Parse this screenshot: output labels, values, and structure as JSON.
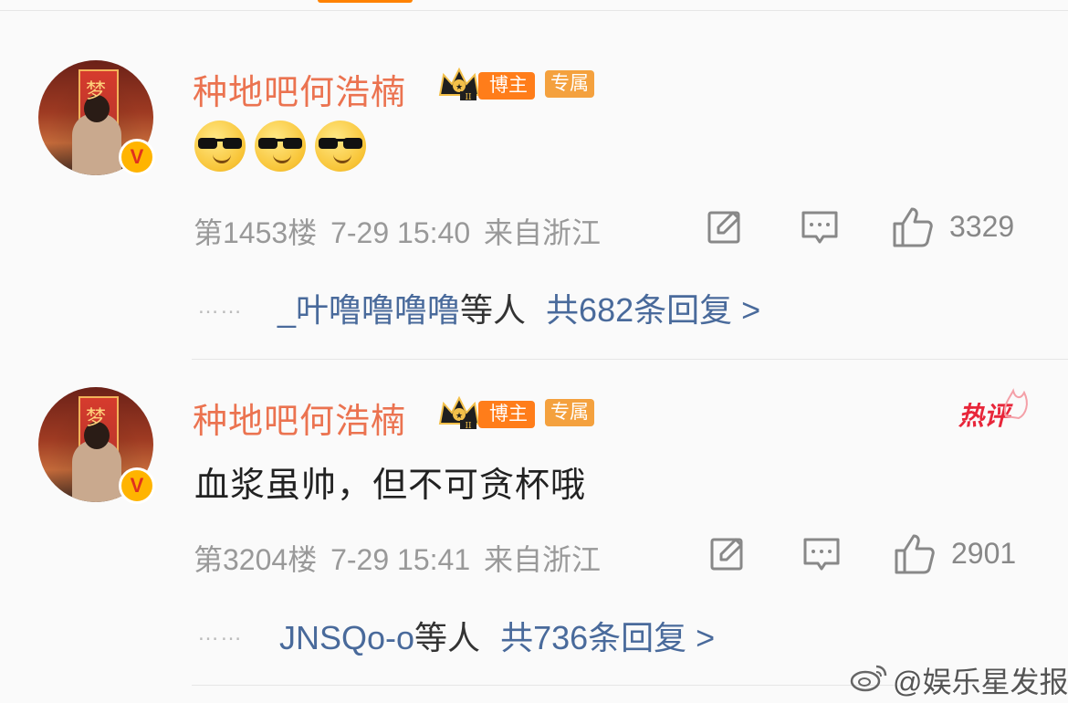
{
  "comments": [
    {
      "username": "种地吧何浩楠",
      "badge_level": "II",
      "badge_blogger": "博主",
      "badge_exclusive": "专属",
      "content_emojis": [
        "emoji-cool",
        "emoji-cool",
        "emoji-cool"
      ],
      "floor": "第1453楼",
      "time": "7-29 15:40",
      "location": "来自浙江",
      "likes": "3329",
      "replies_dots": "……",
      "replies_users": "_叶噜噜噜噜",
      "replies_mid": "等人",
      "replies_total": "共682条回复 >"
    },
    {
      "username": "种地吧何浩楠",
      "badge_level": "II",
      "badge_blogger": "博主",
      "badge_exclusive": "专属",
      "hot_label": "热评",
      "content": "血浆虽帅，但不可贪杯哦",
      "floor": "第3204楼",
      "time": "7-29 15:41",
      "location": "来自浙江",
      "likes": "2901",
      "replies_dots": "……",
      "replies_users": "JNSQo-o",
      "replies_mid": "等人",
      "replies_total": "共736条回复 >"
    }
  ],
  "watermark": "@娱乐星发报",
  "colors": {
    "username": "#eb7350",
    "link": "#496a9b",
    "meta": "#999999",
    "accent": "#ff8200",
    "hot": "#e8263a"
  },
  "icons": [
    "verified-v-icon",
    "crown-icon",
    "repost-icon",
    "comment-icon",
    "like-icon",
    "weibo-logo-icon"
  ]
}
